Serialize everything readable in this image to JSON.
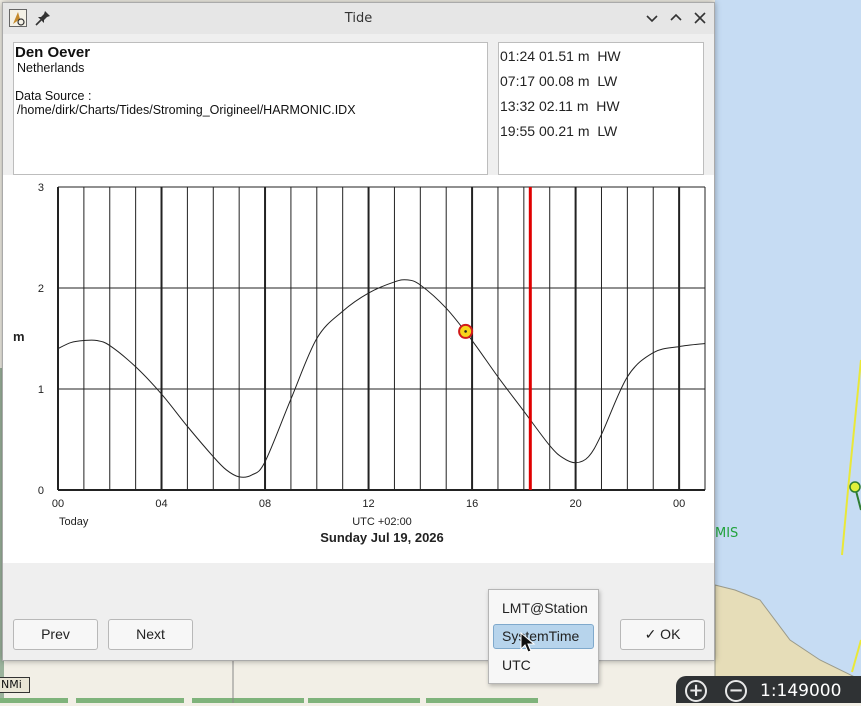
{
  "map": {
    "scale": "1:149000",
    "unit_label": "NMi",
    "place_label": "MIS",
    "zoom_in_icon": "plus-circle-icon",
    "zoom_out_icon": "minus-circle-icon"
  },
  "dialog": {
    "title": "Tide",
    "station": {
      "name": "Den Oever",
      "country": "Netherlands",
      "data_source_label": "Data Source :",
      "data_source_path": "/home/dirk/Charts/Tides/Stroming_Origineel/HARMONIC.IDX"
    },
    "tides": [
      {
        "time": "01:24",
        "height": "01.51 m",
        "type": "HW"
      },
      {
        "time": "07:17",
        "height": "00.08 m",
        "type": "LW"
      },
      {
        "time": "13:32",
        "height": "02.11 m",
        "type": "HW"
      },
      {
        "time": "19:55",
        "height": "00.21 m",
        "type": "LW"
      }
    ],
    "buttons": {
      "prev": "Prev",
      "next": "Next",
      "ok": "✓ OK"
    }
  },
  "chart_data": {
    "type": "line",
    "ylabel": "m",
    "xlabel": "UTC +02:00",
    "day_label": "Today",
    "date_label": "Sunday Jul 19, 2026",
    "ylim": [
      0,
      3
    ],
    "xlim": [
      0,
      25
    ],
    "y_ticks": [
      "0",
      "1",
      "2",
      "3"
    ],
    "x_ticks": [
      {
        "hour": 0,
        "label": "00"
      },
      {
        "hour": 4,
        "label": "04"
      },
      {
        "hour": 8,
        "label": "08"
      },
      {
        "hour": 12,
        "label": "12"
      },
      {
        "hour": 16,
        "label": "16"
      },
      {
        "hour": 20,
        "label": "20"
      },
      {
        "hour": 24,
        "label": "00"
      }
    ],
    "grid": true,
    "current_time_hour": 18.25,
    "marker": {
      "hour": 15.75,
      "value": 1.57
    },
    "colors": {
      "curve": "#222222",
      "now_line": "#e00000",
      "marker_fill": "#f7d51a",
      "marker_stroke": "#d11a1a"
    },
    "series": [
      {
        "x": [
          0,
          0.5,
          1,
          1.5,
          2,
          3,
          4,
          5,
          6,
          6.5,
          7,
          7.5,
          8,
          9,
          10,
          11,
          12,
          13,
          13.5,
          14,
          15,
          16,
          17,
          18,
          19,
          19.5,
          20,
          20.5,
          21,
          22,
          23,
          24,
          25
        ],
        "y": [
          1.4,
          1.46,
          1.48,
          1.48,
          1.43,
          1.22,
          0.95,
          0.63,
          0.33,
          0.2,
          0.13,
          0.15,
          0.28,
          0.9,
          1.5,
          1.77,
          1.95,
          2.06,
          2.08,
          2.03,
          1.8,
          1.48,
          1.12,
          0.78,
          0.44,
          0.32,
          0.27,
          0.33,
          0.55,
          1.12,
          1.36,
          1.42,
          1.45
        ]
      }
    ]
  },
  "timezone_dropdown": {
    "options": [
      "LMT@Station",
      "SystemTime",
      "UTC"
    ],
    "selected": "SystemTime"
  }
}
